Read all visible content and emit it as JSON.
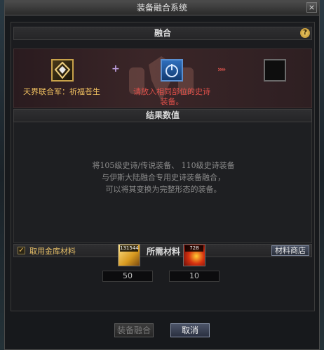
{
  "window": {
    "title": "装备融合系统",
    "close_label": "×"
  },
  "fusion": {
    "header": "融合",
    "help_label": "?",
    "plus_symbol": "+",
    "arrow_symbol": "»»",
    "slot1_name": "天界联合军：祈福苍生",
    "slot2_hint": "请放入相同部位的史诗装备。"
  },
  "result": {
    "header": "结果数值",
    "description_lines": [
      "将105级史诗/传说装备、 110级史诗装备",
      "与伊斯大陆融合专用史诗装备融合，",
      "可以将其变换为完整形态的装备。"
    ]
  },
  "materials": {
    "use_vault_label": "取用金库材料",
    "use_vault_checked": true,
    "header": "所需材料",
    "shop_label": "材料商店",
    "items": [
      {
        "icon": "gold-crystal-icon",
        "owned": "131544",
        "required": "50"
      },
      {
        "icon": "fire-orb-icon",
        "owned": "728",
        "required": "10"
      }
    ]
  },
  "buttons": {
    "fuse": "装备融合",
    "cancel": "取消"
  },
  "colors": {
    "gold": "#f0c060",
    "red": "#e0504a",
    "accent_blue": "#5a8fd0"
  }
}
